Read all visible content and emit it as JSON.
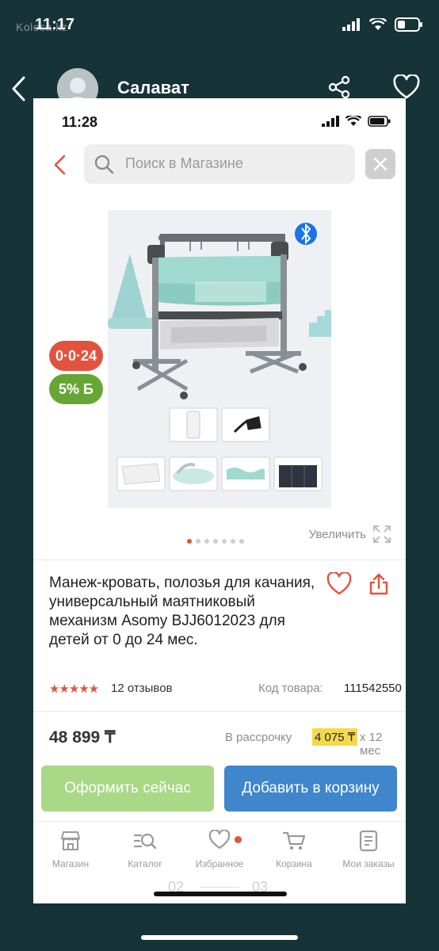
{
  "os": {
    "time": "11:17",
    "watermark": "Kolesa.kz"
  },
  "chat": {
    "contact_name": "Салават"
  },
  "inner_status": {
    "time": "11:28"
  },
  "search": {
    "placeholder": "Поиск в Магазине"
  },
  "badges": {
    "installment": "0·0·24",
    "bonus": "5% Б"
  },
  "gallery": {
    "zoom_label": "Увеличить",
    "image_count": 7,
    "active_index": 0
  },
  "product": {
    "title": "Манеж-кровать, полозья для качания, универсальный маятниковый механизм Asomy BJJ6012023 для детей от 0 до 24 мес.",
    "rating": 5,
    "reviews_label": "12 отзывов",
    "code_label": "Код товара:",
    "code_value": "111542550"
  },
  "price": {
    "value": "48 899 ₸",
    "installment_label": "В рассрочку",
    "installment_amount": "4 075 ₸",
    "installment_term": "х 12 мес"
  },
  "actions": {
    "buy_now": "Оформить сейчас",
    "add_to_cart": "Добавить в корзину"
  },
  "tabbar": [
    {
      "label": "Магазин",
      "icon": "store-icon"
    },
    {
      "label": "Каталог",
      "icon": "catalog-icon"
    },
    {
      "label": "Избранное",
      "icon": "heart-icon",
      "badge": true
    },
    {
      "label": "Корзина",
      "icon": "cart-icon"
    },
    {
      "label": "Мои заказы",
      "icon": "orders-icon"
    }
  ],
  "pager": {
    "left": "02",
    "right": "03"
  },
  "colors": {
    "accent": "#e2523f",
    "buy": "#a9d886",
    "cart": "#3f86cc",
    "bonus": "#67a635",
    "highlight": "#f4d94b",
    "frame": "#163338"
  }
}
